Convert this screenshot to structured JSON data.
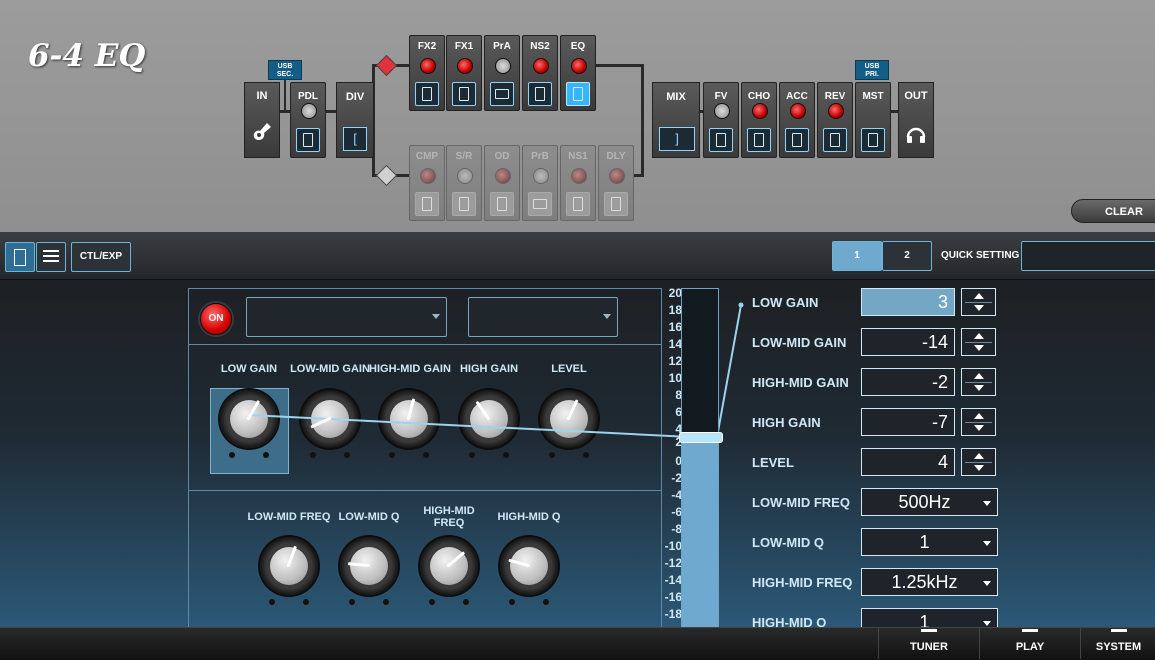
{
  "preset_title": "6-4 EQ",
  "chain": {
    "in_label": "IN",
    "out_label": "OUT",
    "pdl_label": "PDL",
    "div_label": "DIV",
    "mix_label": "MIX",
    "usb_sec": [
      "USB",
      "SEC."
    ],
    "usb_pri": [
      "USB",
      "PRI."
    ],
    "path_a": [
      "FX2",
      "FX1",
      "PrA",
      "NS2",
      "EQ"
    ],
    "path_b": [
      "CMP",
      "S/R",
      "OD",
      "PrB",
      "NS1",
      "DLY"
    ],
    "post": [
      "FV",
      "CHO",
      "ACC",
      "REV",
      "MST"
    ]
  },
  "clear_label": "CLEAR",
  "toolbar": {
    "ctl_exp": "CTL/EXP",
    "tab1": "1",
    "tab2": "2",
    "quick_setting": "QUICK SETTING",
    "quick_setting_value": ""
  },
  "effect": {
    "on_label": "ON",
    "select1_value": "",
    "select2_value": "",
    "knobs_row1": [
      "LOW GAIN",
      "LOW-MID GAIN",
      "HIGH-MID GAIN",
      "HIGH GAIN",
      "LEVEL"
    ],
    "knobs_row2": [
      "LOW-MID FREQ",
      "LOW-MID Q",
      "HIGH-MID\nFREQ",
      "HIGH-MID Q"
    ]
  },
  "scale_ticks": [
    "20",
    "18",
    "16",
    "14",
    "12",
    "10",
    "8",
    "6",
    "4",
    "2",
    "0",
    "-2",
    "-4",
    "-6",
    "-8",
    "-10",
    "-12",
    "-14",
    "-16",
    "-18"
  ],
  "slider": {
    "min": -20,
    "max": 20,
    "value": 3
  },
  "params": [
    {
      "label": "LOW GAIN",
      "value": "3",
      "type": "spin",
      "selected": true
    },
    {
      "label": "LOW-MID GAIN",
      "value": "-14",
      "type": "spin"
    },
    {
      "label": "HIGH-MID GAIN",
      "value": "-2",
      "type": "spin"
    },
    {
      "label": "HIGH GAIN",
      "value": "-7",
      "type": "spin"
    },
    {
      "label": "LEVEL",
      "value": "4",
      "type": "spin"
    },
    {
      "label": "LOW-MID FREQ",
      "value": "500Hz",
      "type": "dropdown"
    },
    {
      "label": "LOW-MID Q",
      "value": "1",
      "type": "dropdown"
    },
    {
      "label": "HIGH-MID FREQ",
      "value": "1.25kHz",
      "type": "dropdown"
    },
    {
      "label": "HIGH-MID Q",
      "value": "1",
      "type": "dropdown"
    }
  ],
  "bottom": {
    "tuner": "TUNER",
    "play": "PLAY",
    "system": "SYSTEM"
  },
  "colors": {
    "accent": "#35b4ff",
    "effect_led": "#d40000",
    "fill": "#6fa9cf"
  }
}
